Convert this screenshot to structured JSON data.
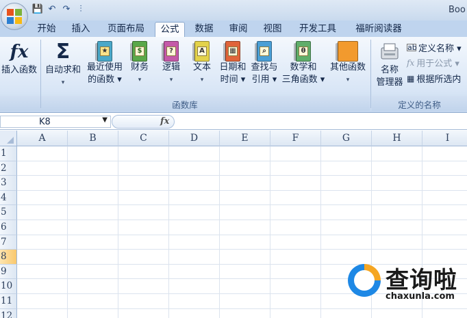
{
  "title_text": "Boo",
  "qat": {
    "save": "💾",
    "undo": "↶",
    "redo": "↷",
    "customize": "⫶"
  },
  "tabs": [
    "开始",
    "插入",
    "页面布局",
    "公式",
    "数据",
    "审阅",
    "视图",
    "开发工具",
    "福昕阅读器"
  ],
  "active_tab": "公式",
  "ribbon": {
    "insert_function": {
      "icon": "fx",
      "label": "插入函数"
    },
    "autosum": {
      "icon": "Σ",
      "line1": "自动求和",
      "line2": "▾"
    },
    "recent": {
      "line1": "最近使用",
      "line2": "的函数 ▾"
    },
    "financial": {
      "line1": "财务",
      "line2": "▾",
      "glyph": "$"
    },
    "logical": {
      "line1": "逻辑",
      "line2": "▾",
      "glyph": "?"
    },
    "text": {
      "line1": "文本",
      "line2": "▾",
      "glyph": "A"
    },
    "datetime": {
      "line1": "日期和",
      "line2": "时间 ▾"
    },
    "lookup": {
      "line1": "查找与",
      "line2": "引用 ▾"
    },
    "math": {
      "line1": "数学和",
      "line2": "三角函数 ▾",
      "glyph": "θ"
    },
    "more": {
      "line1": "其他函数",
      "line2": "▾"
    },
    "group_function_library": "函数库",
    "name_manager": {
      "line1": "名称",
      "line2": "管理器"
    },
    "define_name": "定义名称 ▾",
    "use_in_formula": "用于公式 ▾",
    "create_from_selection": "根据所选内",
    "group_defined_names": "定义的名称"
  },
  "formula_bar": {
    "name_box": "K8",
    "fx": "fx",
    "content": ""
  },
  "columns": [
    "A",
    "B",
    "C",
    "D",
    "E",
    "F",
    "G",
    "H",
    "I"
  ],
  "rows": [
    "1",
    "2",
    "3",
    "4",
    "5",
    "6",
    "7",
    "8",
    "9",
    "10",
    "11",
    "12"
  ],
  "selected_row": "8",
  "watermark": {
    "title": "查询啦",
    "url": "chaxunla.com"
  },
  "colors": {
    "ribbon_top": "#f4f8fd",
    "tab_bar": "#bfd4ee",
    "selected_row": "#f9c86c",
    "accent_blue": "#1e88e5",
    "accent_orange": "#f5a623"
  }
}
